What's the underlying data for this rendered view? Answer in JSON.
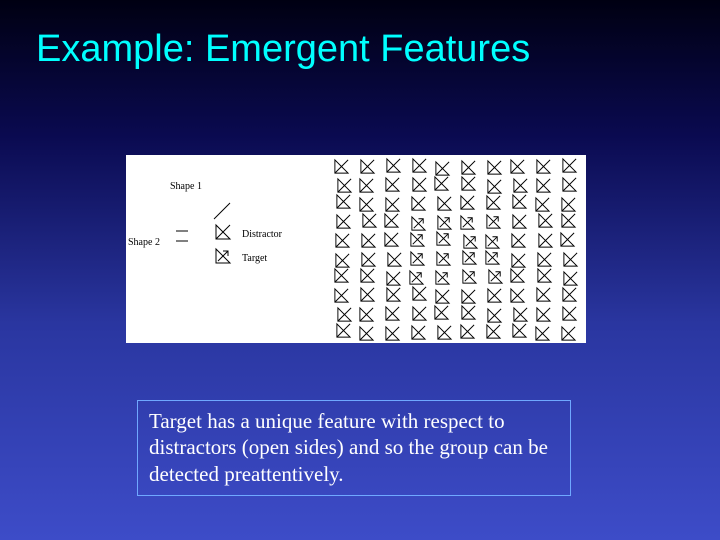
{
  "title": "Example: Emergent Features",
  "legend": {
    "shape1": "Shape 1",
    "shape2": "Shape 2",
    "distractor_label": "Distractor",
    "target_label": "Target"
  },
  "caption": "Target has a unique feature with respect to distractors (open sides) and so the group can be detected preattentively.",
  "array": {
    "cols": 10,
    "rows": 10,
    "target_block": {
      "col_start": 3,
      "col_end": 6,
      "row_start": 3,
      "row_end": 6
    },
    "distractor_glyph": "right-triangle-hypotenuse-br-tl",
    "target_glyph": "right-triangle-with-arrow"
  }
}
